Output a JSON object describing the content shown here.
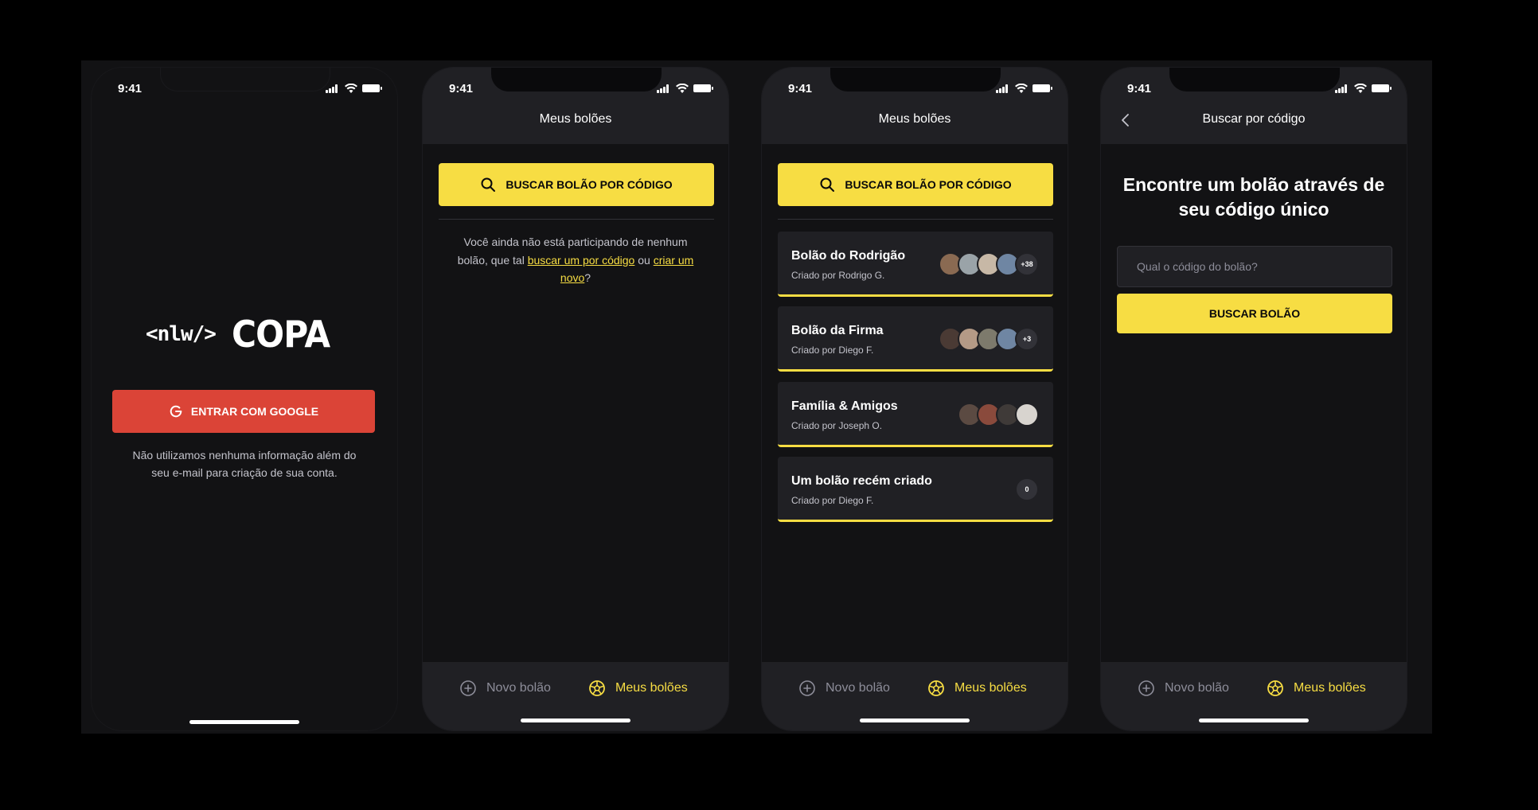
{
  "status_time": "9:41",
  "colors": {
    "accent": "#F7DD43",
    "google": "#DB4437",
    "background": "#121214",
    "surface": "#202024",
    "muted": "#8D8D99"
  },
  "screen1": {
    "logo_left": "<nlw/>",
    "logo_right": "COPA",
    "google_button": "ENTRAR COM GOOGLE",
    "note": "Não utilizamos nenhuma informação além do seu e-mail para criação de sua conta."
  },
  "screen2": {
    "header_title": "Meus bolões",
    "search_button": "BUSCAR BOLÃO POR CÓDIGO",
    "empty_text_1": "Você ainda não está participando de nenhum bolão, que tal ",
    "empty_link_1": "buscar um por código",
    "empty_text_2": " ou ",
    "empty_link_2": "criar um novo",
    "empty_text_3": "?"
  },
  "screen3": {
    "header_title": "Meus bolões",
    "search_button": "BUSCAR BOLÃO POR CÓDIGO",
    "pools": [
      {
        "title": "Bolão do Rodrigão",
        "subtitle": "Criado por Rodrigo G.",
        "extra": "+38"
      },
      {
        "title": "Bolão da Firma",
        "subtitle": "Criado por Diego F.",
        "extra": "+3"
      },
      {
        "title": "Família & Amigos",
        "subtitle": "Criado por Joseph O.",
        "extra": ""
      },
      {
        "title": "Um bolão recém criado",
        "subtitle": "Criado por Diego F.",
        "extra": "0"
      }
    ]
  },
  "screen4": {
    "header_title": "Buscar por código",
    "heading": "Encontre um bolão através de seu código único",
    "input_placeholder": "Qual o código do bolão?",
    "find_button": "BUSCAR BOLÃO"
  },
  "tabs": {
    "new_pool": "Novo bolão",
    "my_pools": "Meus bolões"
  },
  "icons": {
    "search": "search-icon",
    "google": "google-icon",
    "plus": "plus-circle-icon",
    "ball": "soccer-ball-icon",
    "back": "chevron-left-icon"
  }
}
